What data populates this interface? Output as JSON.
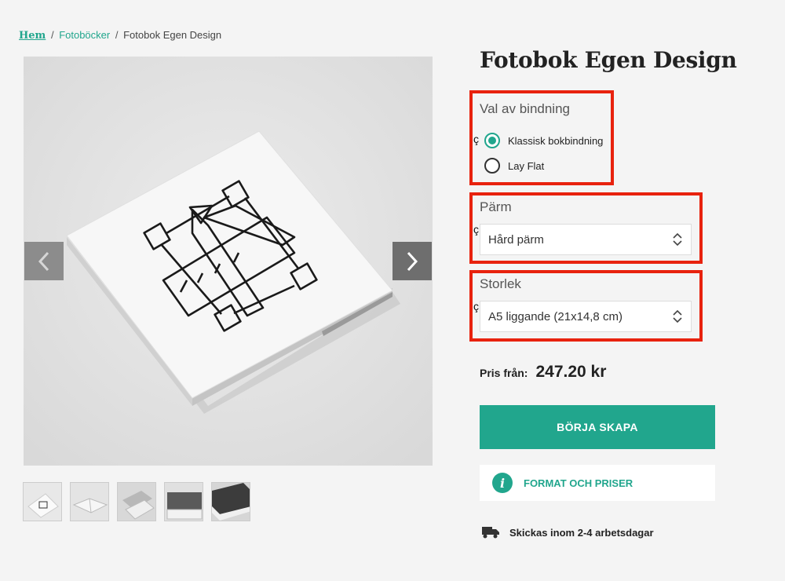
{
  "breadcrumb": {
    "home": "Hem",
    "sep1": "/",
    "category": "Fotoböcker",
    "sep2": "/",
    "current": "Fotobok Egen Design"
  },
  "product": {
    "title": "Fotobok Egen Design"
  },
  "binding": {
    "label": "Val av bindning",
    "marker": "ç",
    "options": [
      {
        "label": "Klassisk bokbindning",
        "checked": true
      },
      {
        "label": "Lay Flat",
        "checked": false
      }
    ]
  },
  "cover": {
    "label": "Pärm",
    "marker": "ç",
    "selected": "Hård pärm"
  },
  "size": {
    "label": "Storlek",
    "marker": "ç",
    "selected": "A5 liggande (21x14,8 cm)"
  },
  "price": {
    "label": "Pris från:",
    "value": "247.20 kr"
  },
  "cta": {
    "label": "BÖRJA SKAPA"
  },
  "info": {
    "label": "FORMAT OCH PRISER",
    "icon_glyph": "i"
  },
  "shipping": {
    "label": "Skickas inom 2-4 arbetsdagar"
  },
  "colors": {
    "accent": "#21a68d",
    "highlight": "#e8220e"
  },
  "icons": {
    "prev": "chevron-left-icon",
    "next": "chevron-right-icon",
    "info": "info-icon",
    "truck": "truck-icon",
    "select": "updown-arrows-icon"
  }
}
